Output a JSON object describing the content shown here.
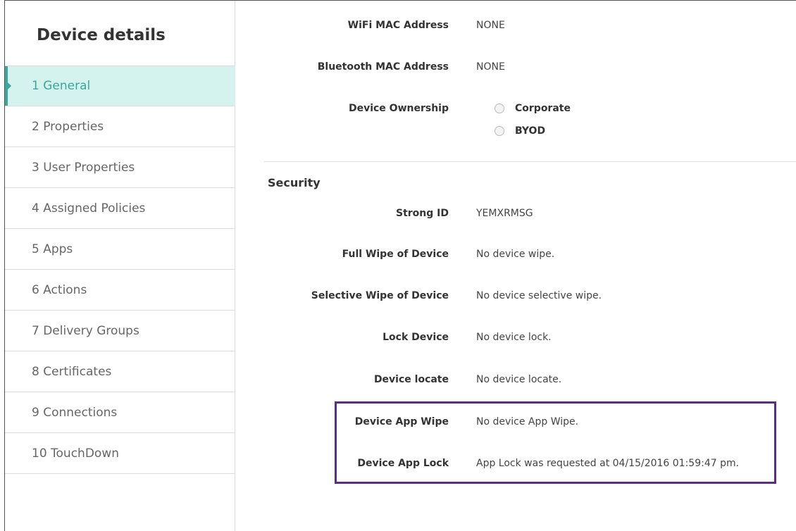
{
  "sidebar": {
    "title": "Device details",
    "items": [
      {
        "label": "1  General"
      },
      {
        "label": "2  Properties"
      },
      {
        "label": "3  User Properties"
      },
      {
        "label": "4  Assigned Policies"
      },
      {
        "label": "5  Apps"
      },
      {
        "label": "6  Actions"
      },
      {
        "label": "7  Delivery Groups"
      },
      {
        "label": "8  Certificates"
      },
      {
        "label": "9  Connections"
      },
      {
        "label": "10  TouchDown"
      }
    ]
  },
  "general": {
    "wifi_mac_label": "WiFi MAC Address",
    "wifi_mac_value": "NONE",
    "bt_mac_label": "Bluetooth MAC Address",
    "bt_mac_value": "NONE",
    "ownership_label": "Device Ownership",
    "ownership_options": [
      "Corporate",
      "BYOD"
    ]
  },
  "security": {
    "title": "Security",
    "strong_id_label": "Strong ID",
    "strong_id_value": "YEMXRMSG",
    "full_wipe_label": "Full Wipe of Device",
    "full_wipe_value": "No device wipe.",
    "selective_wipe_label": "Selective Wipe of Device",
    "selective_wipe_value": "No device selective wipe.",
    "lock_label": "Lock Device",
    "lock_value": "No device lock.",
    "locate_label": "Device locate",
    "locate_value": "No device locate.",
    "app_wipe_label": "Device App Wipe",
    "app_wipe_value": "No device App Wipe.",
    "app_lock_label": "Device App Lock",
    "app_lock_value": "App Lock was requested at 04/15/2016 01:59:47 pm."
  },
  "colors": {
    "accent": "#3aa79a",
    "active_bg": "#d4f3ef",
    "highlight_border": "#5b2d86"
  }
}
